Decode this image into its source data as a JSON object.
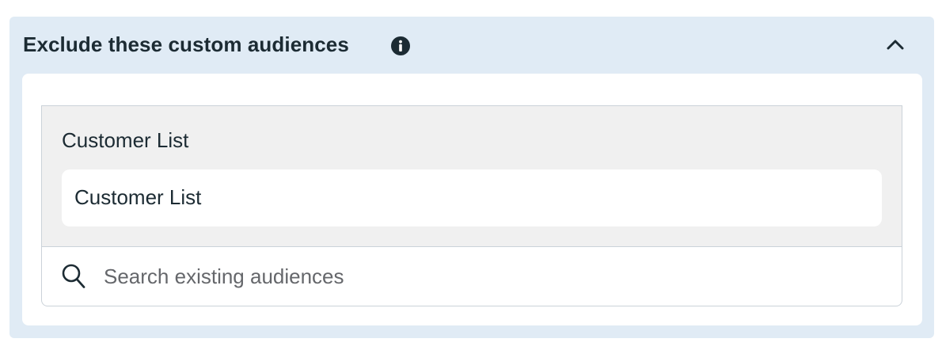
{
  "section": {
    "title": "Exclude these custom audiences",
    "info_icon": "info-circle-icon",
    "collapse_icon": "chevron-up-icon",
    "background_color": "#e0ebf5",
    "title_color": "#1c2b33"
  },
  "selected_group": {
    "label": "Customer List",
    "items": [
      {
        "label": "Customer List"
      }
    ]
  },
  "search": {
    "icon": "search-icon",
    "value": "",
    "placeholder": "Search existing audiences"
  }
}
